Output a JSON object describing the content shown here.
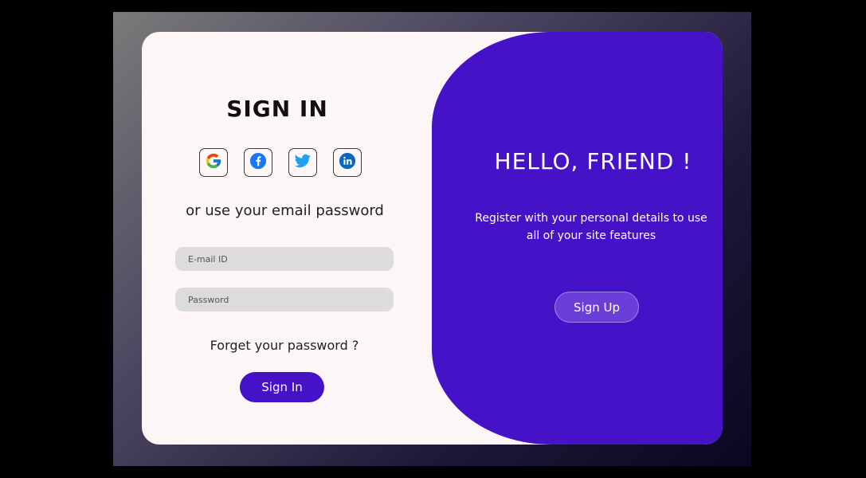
{
  "signin": {
    "title": "SIGN IN",
    "alt_text": "or use your email password",
    "email_placeholder": "E-mail ID",
    "password_placeholder": "Password",
    "forgot_text": "Forget your password ?",
    "button_label": "Sign In",
    "social": [
      {
        "name": "google-icon"
      },
      {
        "name": "facebook-icon"
      },
      {
        "name": "twitter-icon"
      },
      {
        "name": "linkedin-icon"
      }
    ]
  },
  "welcome": {
    "title": "HELLO, FRIEND !",
    "description": "Register with your personal details to use all of your site features",
    "button_label": "Sign Up"
  },
  "colors": {
    "accent": "#4512c8",
    "card_bg": "#fcf7f6",
    "input_bg": "#dcdcdc"
  }
}
